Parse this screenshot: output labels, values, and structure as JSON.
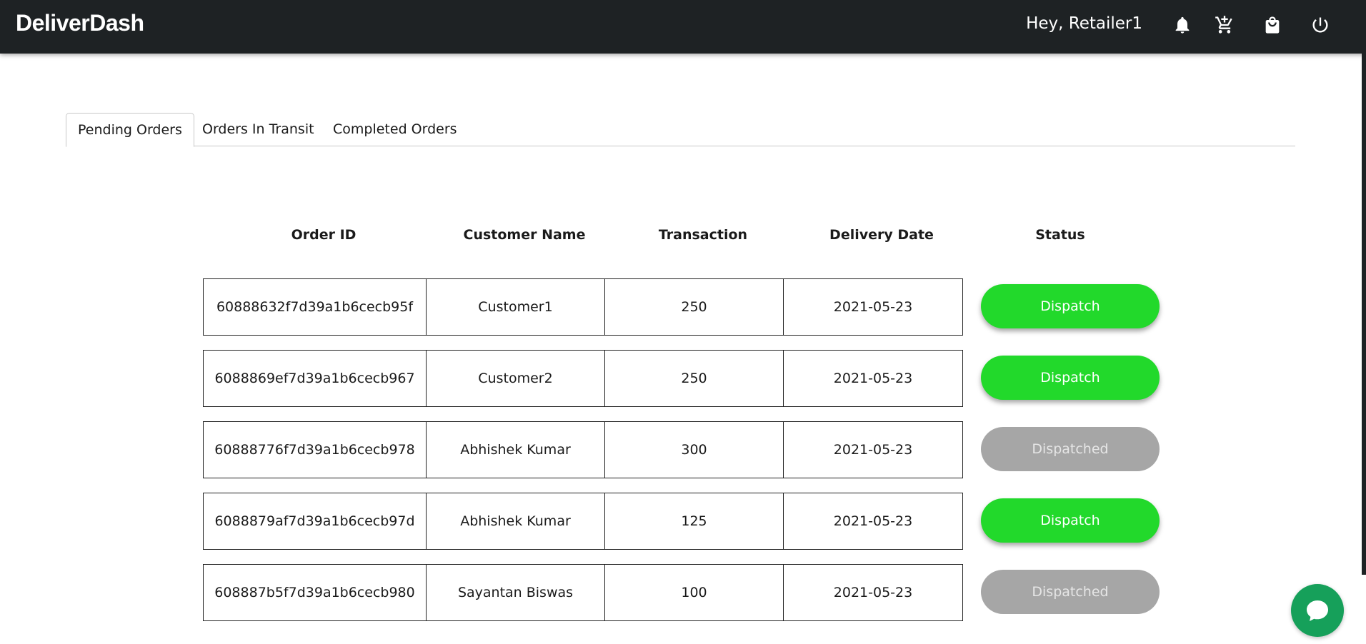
{
  "header": {
    "brand": "DeliverDash",
    "greeting": "Hey, Retailer1",
    "icons": [
      "bell-icon",
      "add-to-cart-icon",
      "shopping-bag-icon",
      "power-icon"
    ]
  },
  "tabs": [
    {
      "label": "Pending Orders",
      "active": true
    },
    {
      "label": "Orders In Transit",
      "active": false
    },
    {
      "label": "Completed Orders",
      "active": false
    }
  ],
  "table": {
    "columns": [
      "Order ID",
      "Customer Name",
      "Transaction",
      "Delivery Date",
      "Status"
    ],
    "rows": [
      {
        "order_id": "60888632f7d39a1b6cecb95f",
        "customer": "Customer1",
        "transaction": "250",
        "date": "2021-05-23",
        "status": "Dispatch",
        "dispatched": false
      },
      {
        "order_id": "6088869ef7d39a1b6cecb967",
        "customer": "Customer2",
        "transaction": "250",
        "date": "2021-05-23",
        "status": "Dispatch",
        "dispatched": false
      },
      {
        "order_id": "60888776f7d39a1b6cecb978",
        "customer": "Abhishek Kumar",
        "transaction": "300",
        "date": "2021-05-23",
        "status": "Dispatched",
        "dispatched": true
      },
      {
        "order_id": "6088879af7d39a1b6cecb97d",
        "customer": "Abhishek Kumar",
        "transaction": "125",
        "date": "2021-05-23",
        "status": "Dispatch",
        "dispatched": false
      },
      {
        "order_id": "608887b5f7d39a1b6cecb980",
        "customer": "Sayantan Biswas",
        "transaction": "100",
        "date": "2021-05-23",
        "status": "Dispatched",
        "dispatched": true
      }
    ]
  },
  "colors": {
    "header_bg": "#1e2224",
    "dispatch": "#22d92b",
    "dispatched": "#a6a6a6",
    "chat": "#16a05a"
  },
  "chat": {
    "icon": "chat-bubble-icon"
  }
}
